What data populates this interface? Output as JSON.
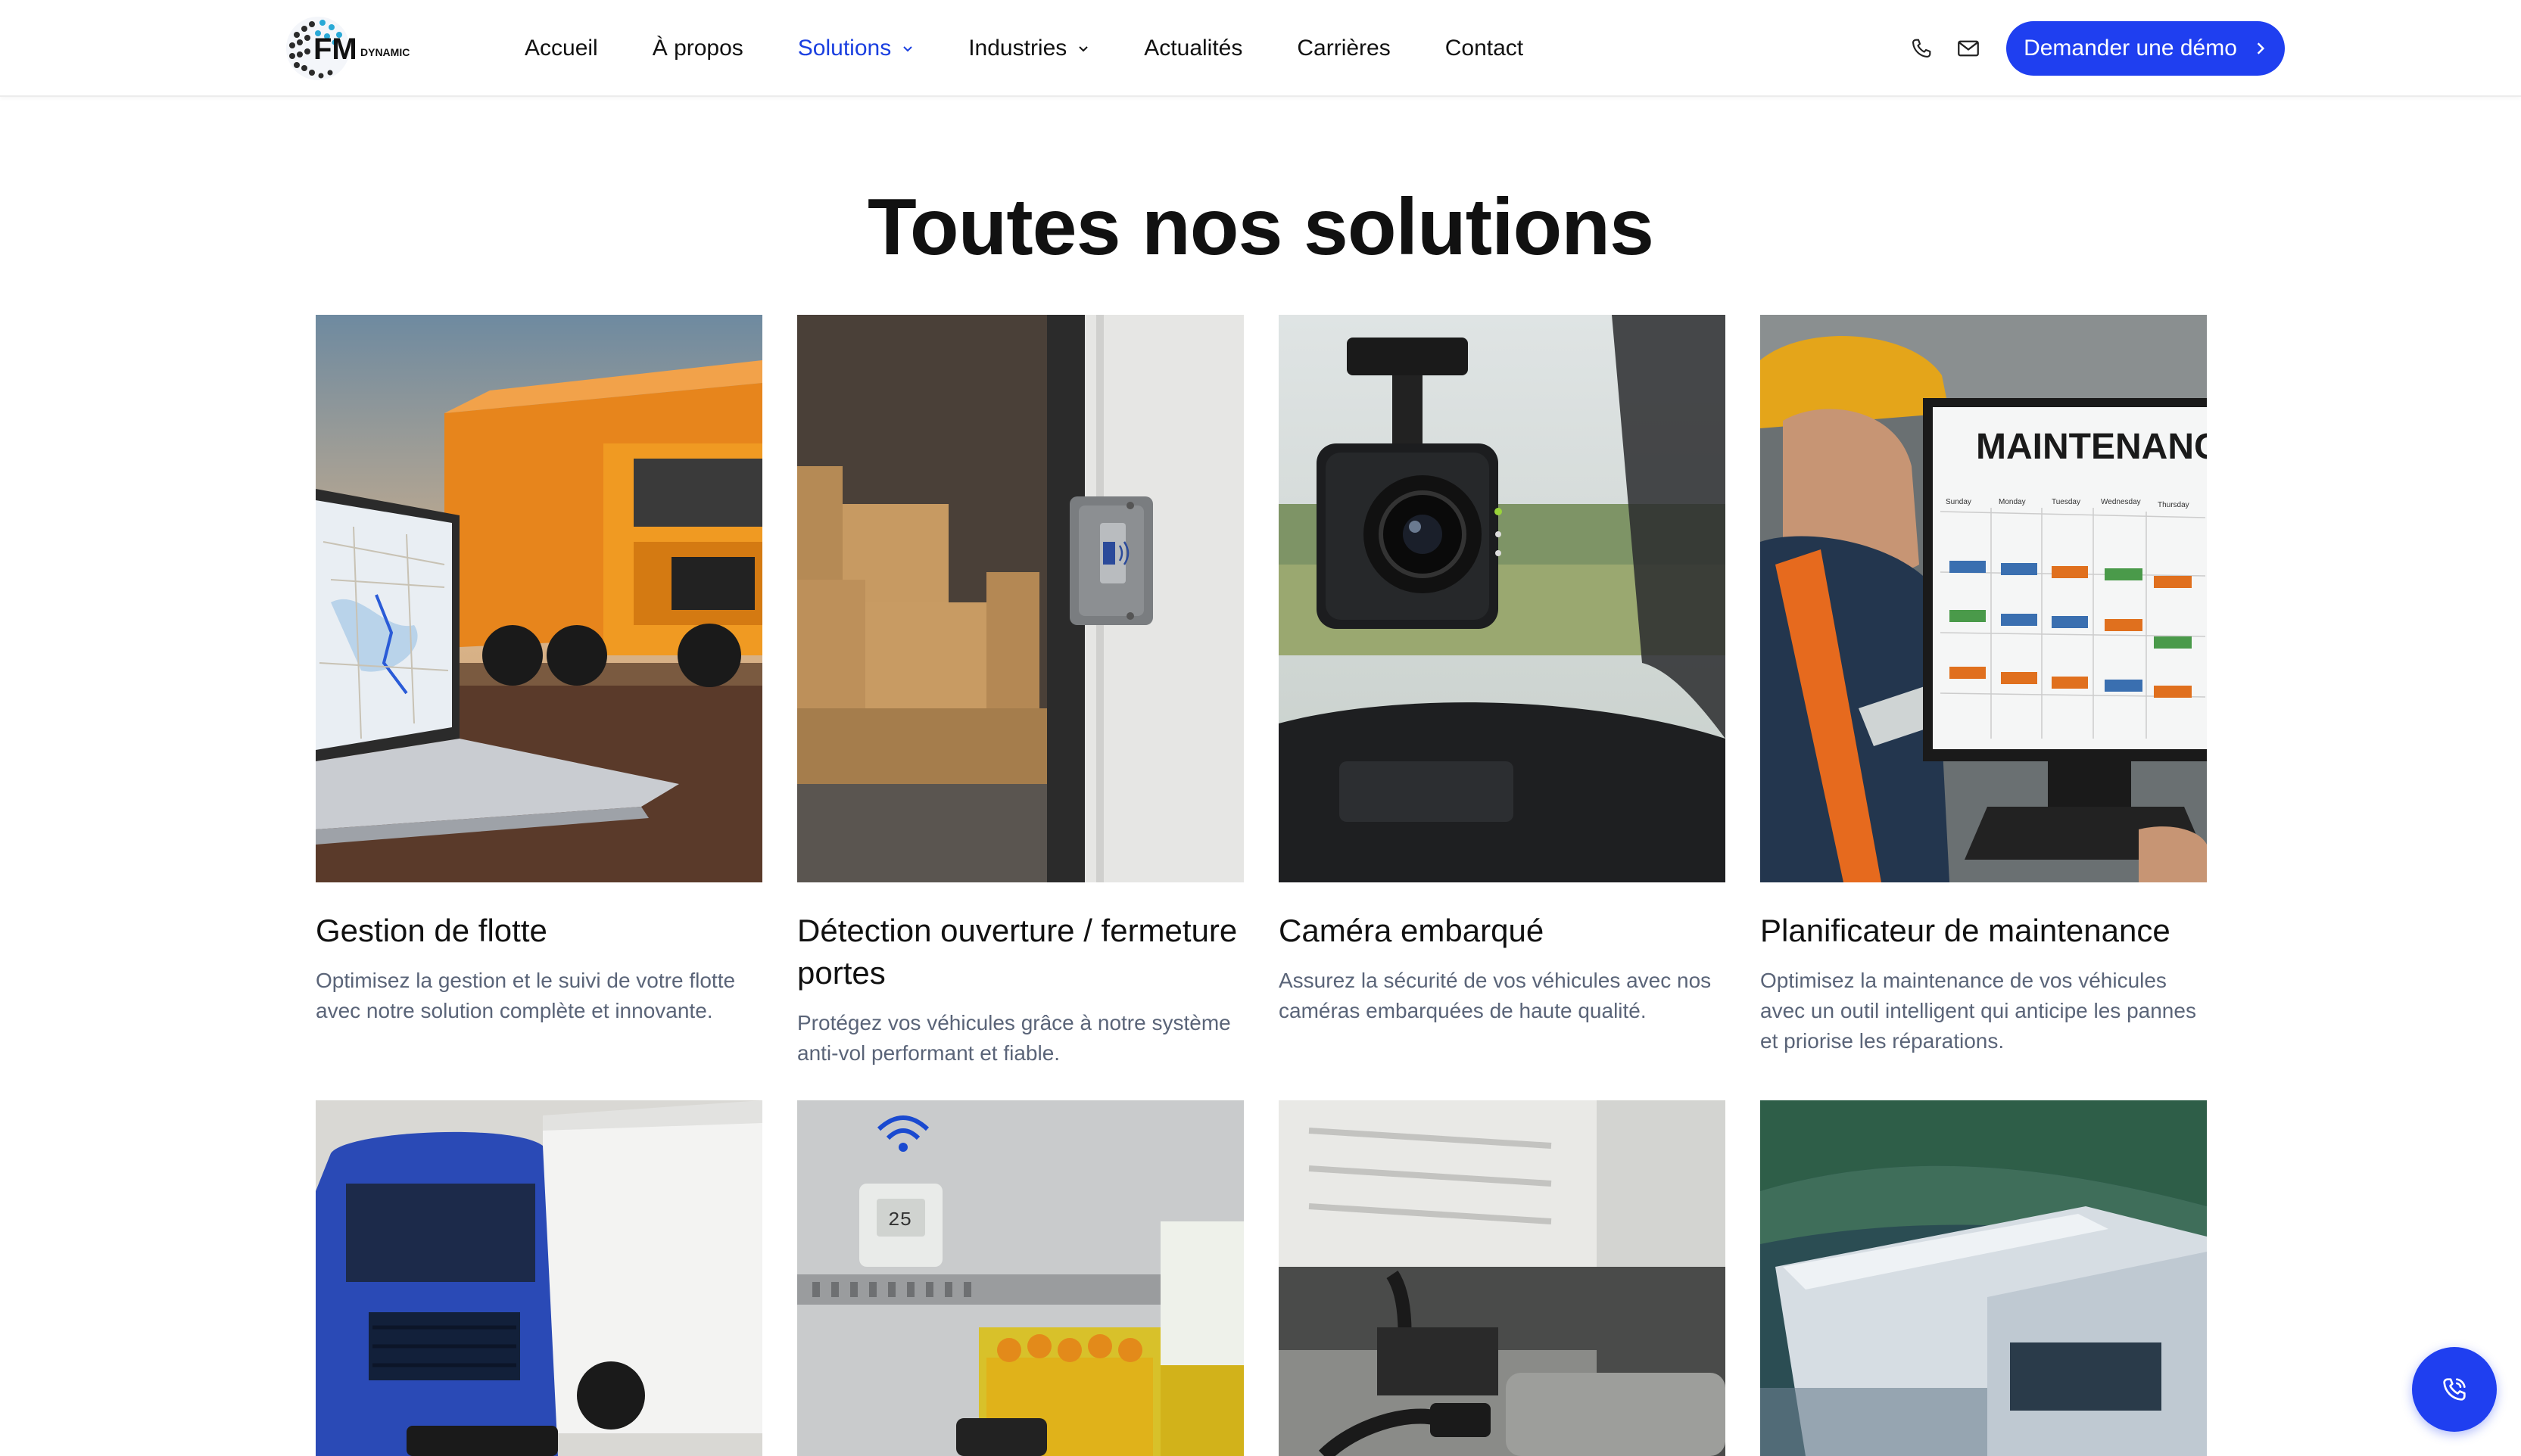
{
  "header": {
    "logo_text": "FM",
    "logo_subtext": "DYNAMIC",
    "nav": [
      {
        "label": "Accueil",
        "dropdown": false,
        "active": false
      },
      {
        "label": "À propos",
        "dropdown": false,
        "active": false
      },
      {
        "label": "Solutions",
        "dropdown": true,
        "active": true
      },
      {
        "label": "Industries",
        "dropdown": true,
        "active": false
      },
      {
        "label": "Actualités",
        "dropdown": false,
        "active": false
      },
      {
        "label": "Carrières",
        "dropdown": false,
        "active": false
      },
      {
        "label": "Contact",
        "dropdown": false,
        "active": false
      }
    ],
    "icons": [
      "phone-icon",
      "mail-icon"
    ],
    "cta_label": "Demander une démo"
  },
  "page": {
    "title": "Toutes nos solutions"
  },
  "cards": [
    {
      "title": "Gestion de flotte",
      "description": "Optimisez la gestion et le suivi de votre flotte avec notre solution complète et innovante."
    },
    {
      "title": "Détection ouverture / fermeture portes",
      "description": "Protégez vos véhicules grâce à notre système anti-vol performant et fiable."
    },
    {
      "title": "Caméra embarqué",
      "description": "Assurez la sécurité de vos véhicules avec nos caméras embarquées de haute qualité."
    },
    {
      "title": "Planificateur de maintenance",
      "description": "Optimisez la maintenance de vos véhicules avec un outil intelligent qui anticipe les pannes et priorise les réparations."
    }
  ],
  "maintenance_screen": {
    "heading": "MAINTENANCE",
    "days": [
      "Sunday",
      "Monday",
      "Tuesday",
      "Wednesday",
      "Thursday"
    ]
  },
  "sensor_display": "25",
  "colors": {
    "accent": "#1f3ff0",
    "active_nav": "#1a3fe0",
    "description": "#5a6478"
  },
  "floating_button_icon": "phone-call-icon"
}
